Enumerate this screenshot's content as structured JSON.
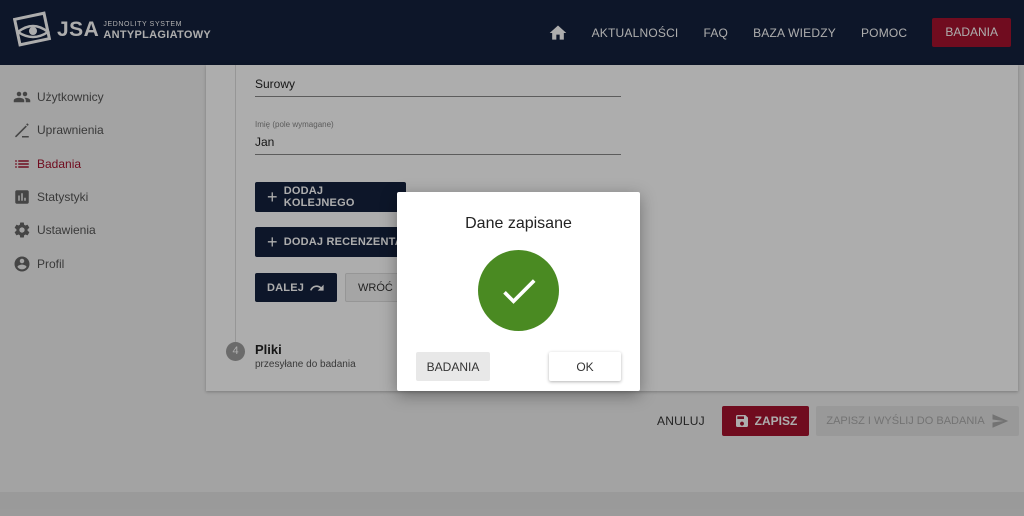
{
  "header": {
    "logo": {
      "brand": "JSA",
      "line1": "JEDNOLITY SYSTEM",
      "line2": "ANTYPLAGIATOWY"
    },
    "nav": [
      "AKTUALNOŚCI",
      "FAQ",
      "BAZA WIEDZY",
      "POMOC"
    ],
    "nav_button": "BADANIA"
  },
  "sidebar": {
    "items": [
      {
        "label": "Użytkownicy",
        "icon": "users-icon"
      },
      {
        "label": "Uprawnienia",
        "icon": "permissions-icon"
      },
      {
        "label": "Badania",
        "icon": "list-icon"
      },
      {
        "label": "Statystyki",
        "icon": "chart-icon"
      },
      {
        "label": "Ustawienia",
        "icon": "gear-icon"
      },
      {
        "label": "Profil",
        "icon": "profile-icon"
      }
    ],
    "active_index": 2
  },
  "form": {
    "surname": {
      "value": "Surowy"
    },
    "name": {
      "label": "Imię (pole wymagane)",
      "value": "Jan"
    },
    "add_next_label": "DODAJ KOLEJNEGO",
    "add_reviewer_label": "DODAJ RECENZENTA",
    "next_label": "DALEJ",
    "back_label": "WRÓĆ",
    "step": {
      "number": "4",
      "title": "Pliki",
      "subtitle": "przesyłane do badania"
    }
  },
  "actions": {
    "cancel": "ANULUJ",
    "save": "ZAPISZ",
    "save_send": "ZAPISZ I WYŚLIJ DO BADANIA"
  },
  "dialog": {
    "title": "Dane zapisane",
    "btn_left": "BADANIA",
    "btn_right": "OK"
  },
  "colors": {
    "navy": "#14213d",
    "accent": "#a5132e",
    "success": "#4a8a22"
  }
}
